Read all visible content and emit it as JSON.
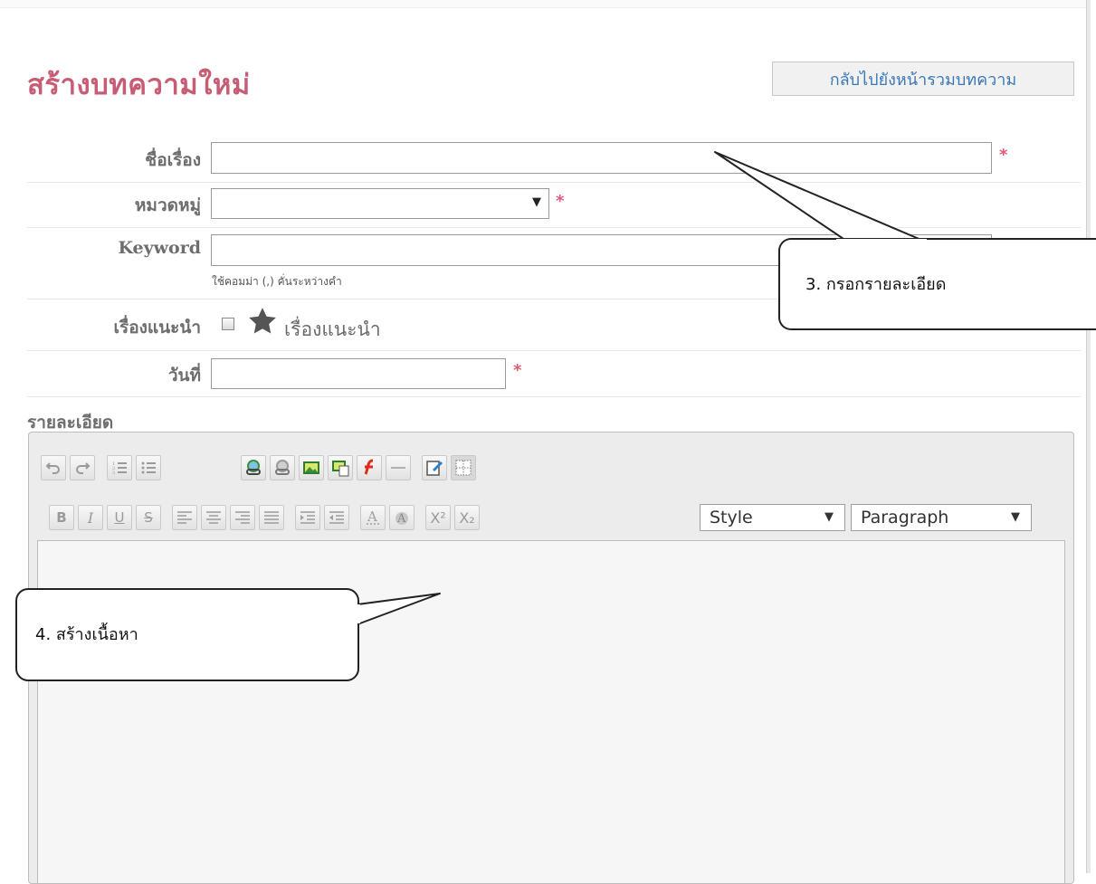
{
  "header": {
    "title": "สร้างบทความใหม่",
    "back_button_label": "กลับไปยังหน้ารวมบทความ"
  },
  "form": {
    "title_label": "ชื่อเรื่อง",
    "category_label": "หมวดหมู่",
    "keyword_label": "Keyword",
    "keyword_hint": "ใช้คอมม่า (,) คั่นระหว่างคำ",
    "featured_label": "เรื่องแนะนำ",
    "featured_checkbox_label": "เรื่องแนะนำ",
    "date_label": "วันที่",
    "detail_label": "รายละเอียด",
    "required_mark": "*",
    "category_value": "",
    "title_value": "",
    "keyword_value": "",
    "date_value": ""
  },
  "toolbar": {
    "bold": "B",
    "italic": "I",
    "underline": "U",
    "strike": "S",
    "superscript": "X²",
    "subscript": "X₂",
    "style_select": "Style",
    "format_select": "Paragraph"
  },
  "callouts": {
    "step3": "3. กรอกรายละเอียด",
    "step4": "4. สร้างเนื้อหา"
  },
  "colors": {
    "title": "#c75d74",
    "link": "#3b78b8",
    "required": "#e05a7a"
  }
}
